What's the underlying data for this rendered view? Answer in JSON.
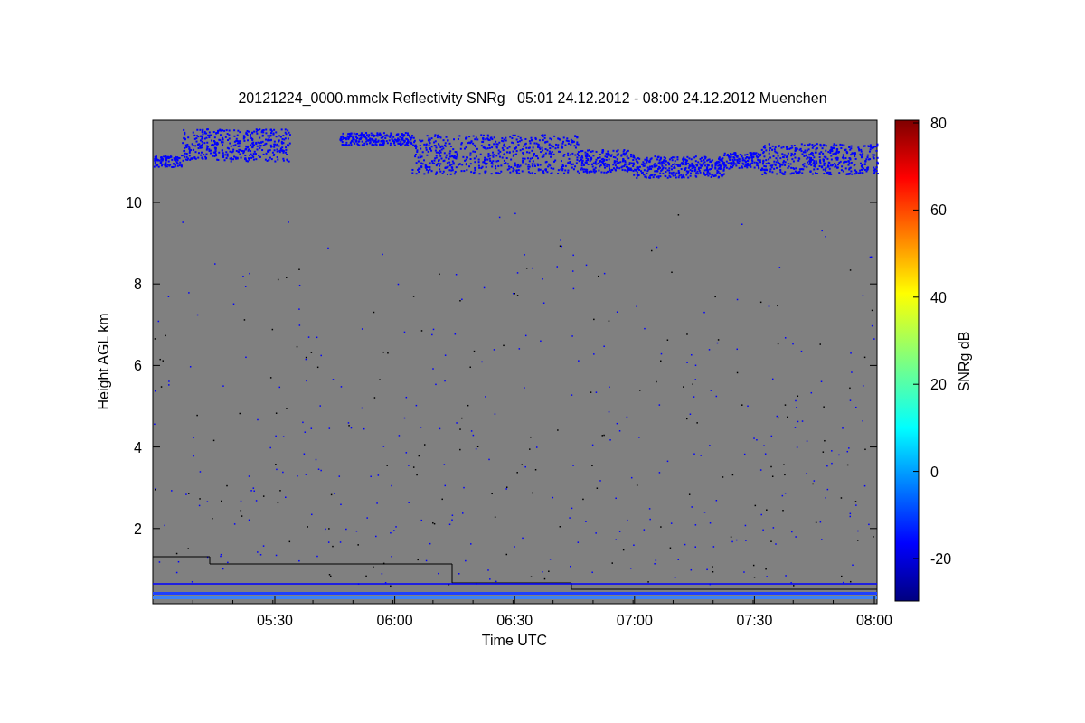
{
  "title": "20121224_0000.mmclx Reflectivity SNRg   05:01 24.12.2012 - 08:00 24.12.2012 Muenchen",
  "x_axis": {
    "label": "Time UTC",
    "ticks": [
      "05:30",
      "06:00",
      "06:30",
      "07:00",
      "07:30",
      "08:00"
    ]
  },
  "y_axis": {
    "label": "Height AGL km",
    "ticks": [
      "10",
      "8",
      "6",
      "4",
      "2"
    ]
  },
  "colorbar": {
    "label": "SNRg dB",
    "ticks": [
      "80",
      "60",
      "40",
      "20",
      "0",
      "-20"
    ]
  }
}
